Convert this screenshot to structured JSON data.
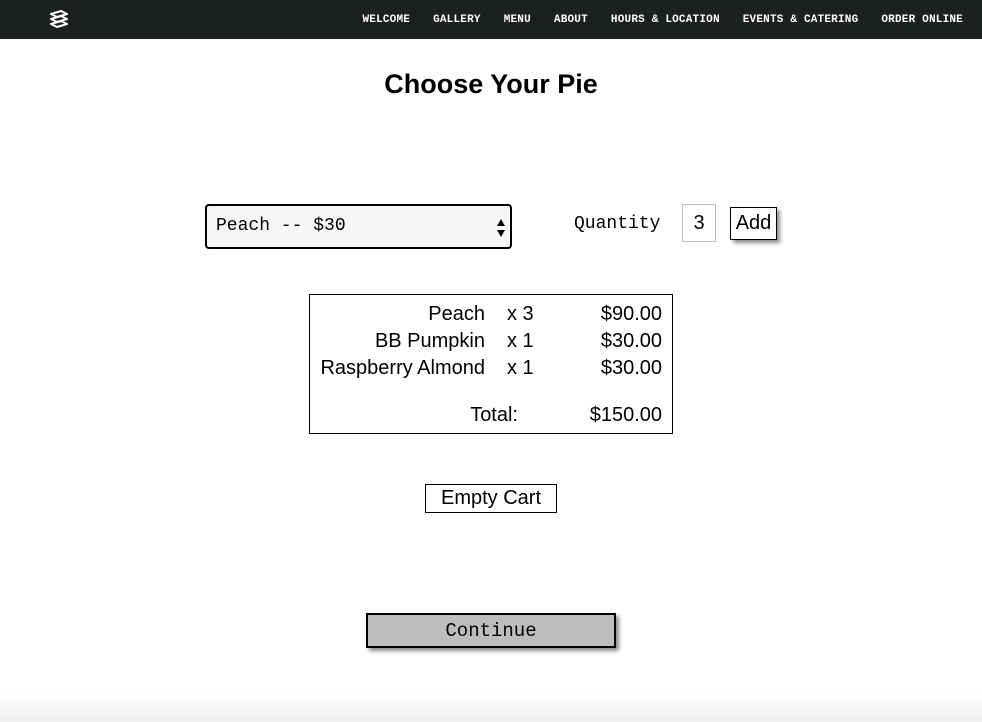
{
  "nav": {
    "logo_icon": "layered-pie-logo-icon",
    "items": [
      "WELCOME",
      "GALLERY",
      "MENU",
      "ABOUT",
      "HOURS & LOCATION",
      "EVENTS & CATERING",
      "ORDER ONLINE"
    ]
  },
  "page": {
    "title": "Choose Your Pie"
  },
  "order": {
    "selected_pie": "Peach -- $30",
    "quantity_label": "Quantity",
    "quantity_value": "3",
    "add_label": "Add"
  },
  "cart": {
    "items": [
      {
        "name": "Peach",
        "qty": "x 3",
        "price": "$90.00"
      },
      {
        "name": "BB Pumpkin",
        "qty": "x 1",
        "price": "$30.00"
      },
      {
        "name": "Raspberry Almond",
        "qty": "x 1",
        "price": "$30.00"
      }
    ],
    "total_label": "Total:",
    "total_value": "$150.00",
    "empty_label": "Empty Cart"
  },
  "actions": {
    "continue_label": "Continue"
  },
  "colors": {
    "nav_bg": "#1c201e",
    "continue_bg": "#bdbdbd",
    "select_bg": "#f6f6f6"
  }
}
